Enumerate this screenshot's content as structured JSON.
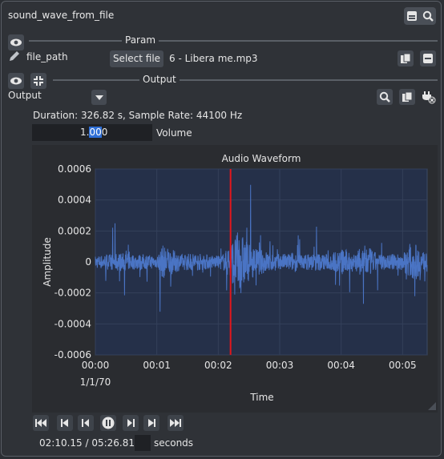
{
  "node": {
    "title": "sound_wave_from_file"
  },
  "param_section": {
    "label": "Param",
    "field_name": "file_path",
    "select_button": "Select file",
    "file_name": "6 - Libera me.mp3"
  },
  "output_section": {
    "label": "Output",
    "port_label": "Output",
    "info": "Duration: 326.82 s, Sample Rate: 44100 Hz"
  },
  "volume": {
    "value_prefix": "1.",
    "value_selected": "00",
    "value_suffix": "0",
    "label": "Volume"
  },
  "playback": {
    "time_display": "02:10.15 / 05:26.81",
    "seconds_label": "seconds"
  },
  "colors": {
    "waveform": "#4a74c4",
    "playhead": "#e3161b",
    "plot_bg": "#253049",
    "accent": "#2f6fd6",
    "green": "#6fd26f"
  },
  "icons": [
    "eye-icon",
    "pencil-icon",
    "collapse-icon",
    "clipboard-icon",
    "minus-icon",
    "zoom-icon",
    "print-icon",
    "plug-icon"
  ],
  "chart_data": {
    "type": "line",
    "title": "Audio Waveform",
    "xlabel": "Time",
    "ylabel": "Amplitude",
    "x_date_label": "1/1/70",
    "x_ticks": [
      "00:00",
      "00:01",
      "00:02",
      "00:03",
      "00:04",
      "00:05"
    ],
    "y_ticks": [
      "0.0006",
      "0.0004",
      "0.0002",
      "0",
      "-0.0002",
      "-0.0004",
      "-0.0006"
    ],
    "ylim": [
      -0.0006,
      0.0006
    ],
    "xlim_seconds": [
      0,
      5.4
    ],
    "playhead_seconds": 2.2,
    "grid": true,
    "series": [
      {
        "x": [
          0.0,
          0.2,
          0.4,
          0.6,
          0.8,
          1.0,
          1.1,
          1.2,
          1.4,
          1.6,
          1.8,
          2.0,
          2.1,
          2.2,
          2.3,
          2.35,
          2.4,
          2.5,
          2.6,
          2.8,
          3.0,
          3.2,
          3.4,
          3.6,
          3.8,
          4.0,
          4.2,
          4.4,
          4.6,
          4.8,
          5.0,
          5.2,
          5.4
        ],
        "y": [
          4e-05,
          5e-05,
          6e-05,
          5e-05,
          5e-05,
          4e-05,
          0.00011,
          9e-05,
          5e-05,
          6e-05,
          5e-05,
          4e-05,
          6e-05,
          0.00012,
          0.00018,
          0.00023,
          0.00017,
          0.00012,
          9e-05,
          7e-05,
          5e-05,
          6e-05,
          5e-05,
          6e-05,
          5e-05,
          9e-05,
          6e-05,
          0.00011,
          5e-05,
          5e-05,
          6e-05,
          0.00012,
          5e-05
        ]
      }
    ]
  }
}
